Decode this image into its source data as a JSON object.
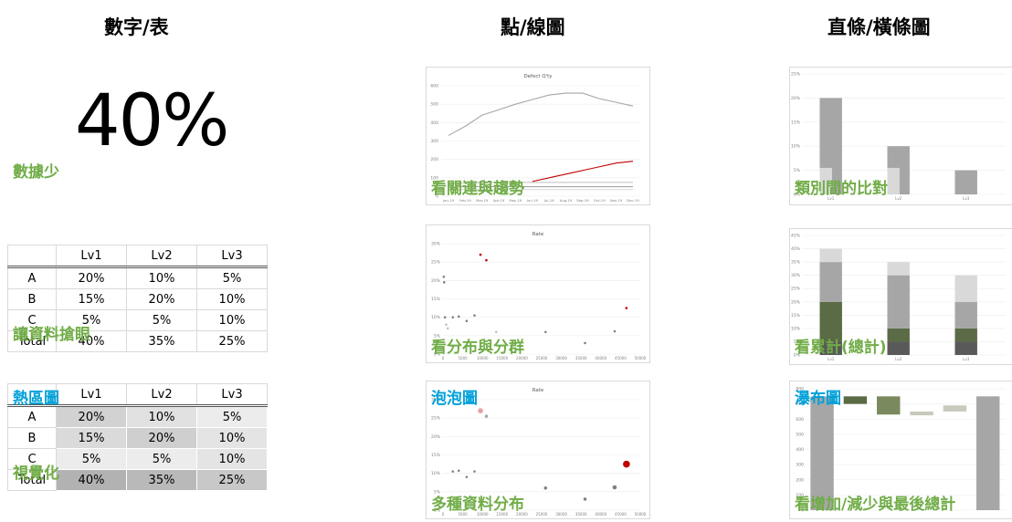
{
  "columns": {
    "numbers": "數字/表",
    "points": "點/線圖",
    "bars": "直條/橫條圖"
  },
  "numbers": {
    "big_value": "40%",
    "caption_few": "數據少",
    "caption_table": "讓資料搶眼",
    "caption_heat_title": "熱區圖",
    "caption_heat": "視覺化",
    "table": {
      "headers": [
        "",
        "Lv1",
        "Lv2",
        "Lv3"
      ],
      "rows": [
        [
          "A",
          "20%",
          "10%",
          "5%"
        ],
        [
          "B",
          "15%",
          "20%",
          "10%"
        ],
        [
          "C",
          "5%",
          "5%",
          "10%"
        ],
        [
          "Total",
          "40%",
          "35%",
          "25%"
        ]
      ]
    },
    "heat_levels": [
      [
        0.55,
        0.35,
        0.2
      ],
      [
        0.45,
        0.6,
        0.3
      ],
      [
        0.2,
        0.2,
        0.3
      ],
      [
        1.0,
        0.9,
        0.7
      ]
    ]
  },
  "cards": {
    "line": {
      "title": "Defect Q'ty",
      "caption": "看關連與趨勢"
    },
    "scatter": {
      "title": "Rate",
      "caption": "看分布與分群"
    },
    "bubble": {
      "title": "Rate",
      "caption_title": "泡泡圖",
      "caption": "多種資料分布"
    },
    "bar": {
      "caption": "類別間的比對"
    },
    "stacked": {
      "caption": "看累計(總計)"
    },
    "waterfall": {
      "caption_title": "瀑布圖",
      "caption": "看增加/減少與最後總計"
    }
  },
  "chart_data": [
    {
      "type": "line",
      "title": "Defect Q'ty",
      "categories": [
        "Jan-19",
        "Feb-19",
        "Mar-19",
        "Apr-19",
        "May-19",
        "Jun-19",
        "Jul-19",
        "Aug-19",
        "Sep-19",
        "Oct-19",
        "Nov-19",
        "Dec-19"
      ],
      "ylim": [
        0,
        600
      ],
      "yticks": [
        "0",
        "100",
        "200",
        "300",
        "400",
        "500",
        "600"
      ],
      "series": [
        {
          "color": "#a6a6a6",
          "values": [
            330,
            380,
            440,
            470,
            500,
            525,
            550,
            560,
            560,
            530,
            510,
            490
          ]
        },
        {
          "color": "#c00000",
          "values": [
            null,
            null,
            null,
            null,
            null,
            80,
            100,
            120,
            140,
            160,
            180,
            190
          ]
        },
        {
          "color": "#bfbfbf",
          "values": [
            70,
            72,
            74,
            75,
            75,
            75,
            75,
            75,
            75,
            75,
            75,
            75
          ]
        },
        {
          "color": "#a6a6a6",
          "values": [
            50,
            52,
            52,
            52,
            52,
            52,
            52,
            52,
            52,
            52,
            52,
            52
          ]
        },
        {
          "color": "#d9d9d9",
          "values": [
            35,
            36,
            36,
            36,
            36,
            36,
            36,
            36,
            36,
            36,
            36,
            36
          ]
        }
      ]
    },
    {
      "type": "scatter",
      "title": "Rate",
      "xlim": [
        0,
        50000
      ],
      "ylim": [
        0,
        0.3
      ],
      "xticks": [
        "0",
        "5000",
        "10000",
        "15000",
        "20000",
        "25000",
        "30000",
        "35000",
        "40000",
        "45000",
        "50000"
      ],
      "yticks": [
        "0%",
        "5%",
        "10%",
        "15%",
        "20%",
        "25%",
        "30%"
      ],
      "points": [
        {
          "x": 200,
          "y": 0.21,
          "c": "#808080"
        },
        {
          "x": 300,
          "y": 0.195,
          "c": "#808080"
        },
        {
          "x": 500,
          "y": 0.1,
          "c": "#808080"
        },
        {
          "x": 800,
          "y": 0.08,
          "c": "#bfbfbf"
        },
        {
          "x": 1200,
          "y": 0.07,
          "c": "#bfbfbf"
        },
        {
          "x": 2500,
          "y": 0.1,
          "c": "#808080"
        },
        {
          "x": 4000,
          "y": 0.102,
          "c": "#808080"
        },
        {
          "x": 6000,
          "y": 0.09,
          "c": "#808080"
        },
        {
          "x": 8000,
          "y": 0.105,
          "c": "#808080"
        },
        {
          "x": 9500,
          "y": 0.27,
          "c": "#c00000"
        },
        {
          "x": 11000,
          "y": 0.255,
          "c": "#c00000"
        },
        {
          "x": 13500,
          "y": 0.06,
          "c": "#bfbfbf"
        },
        {
          "x": 26000,
          "y": 0.06,
          "c": "#808080"
        },
        {
          "x": 36000,
          "y": 0.03,
          "c": "#808080"
        },
        {
          "x": 43500,
          "y": 0.062,
          "c": "#808080"
        },
        {
          "x": 46500,
          "y": 0.125,
          "c": "#c00000"
        }
      ]
    },
    {
      "type": "scatter",
      "title": "Rate",
      "xlim": [
        0,
        50000
      ],
      "ylim": [
        0,
        0.3
      ],
      "xticks": [
        "0",
        "5000",
        "10000",
        "15000",
        "20000",
        "25000",
        "30000",
        "35000",
        "40000",
        "45000",
        "50000"
      ],
      "yticks": [
        "0%",
        "5%",
        "10%",
        "15%",
        "20%",
        "25%",
        "30%"
      ],
      "points": [
        {
          "x": 2500,
          "y": 0.105,
          "c": "#808080",
          "r": 1.5
        },
        {
          "x": 4000,
          "y": 0.107,
          "c": "#808080",
          "r": 1.5
        },
        {
          "x": 6000,
          "y": 0.09,
          "c": "#808080",
          "r": 1.5
        },
        {
          "x": 8000,
          "y": 0.105,
          "c": "#808080",
          "r": 1.5
        },
        {
          "x": 9500,
          "y": 0.27,
          "c": "#e6a0a0",
          "r": 3
        },
        {
          "x": 11000,
          "y": 0.255,
          "c": "#a6a6a6",
          "r": 2
        },
        {
          "x": 26000,
          "y": 0.06,
          "c": "#808080",
          "r": 2
        },
        {
          "x": 36000,
          "y": 0.03,
          "c": "#808080",
          "r": 2
        },
        {
          "x": 43500,
          "y": 0.062,
          "c": "#808080",
          "r": 2.5
        },
        {
          "x": 46500,
          "y": 0.125,
          "c": "#c00000",
          "r": 4
        }
      ]
    },
    {
      "type": "bar",
      "categories": [
        "Lv1",
        "Lv2",
        "Lv3"
      ],
      "ylim": [
        0,
        0.25
      ],
      "yticks": [
        "0%",
        "5%",
        "10%",
        "15%",
        "20%",
        "25%"
      ],
      "values": [
        0.2,
        0.1,
        0.05
      ],
      "highlight": [
        0.055,
        0.055,
        0
      ]
    },
    {
      "type": "bar",
      "stacked": true,
      "categories": [
        "Lv1",
        "Lv2",
        "Lv3"
      ],
      "ylim": [
        0,
        0.45
      ],
      "yticks": [
        "0%",
        "5%",
        "10%",
        "15%",
        "20%",
        "25%",
        "30%",
        "35%",
        "40%",
        "45%"
      ],
      "series": [
        {
          "color": "#595959",
          "values": [
            0.05,
            0.05,
            0.05
          ]
        },
        {
          "color": "#5a6b46",
          "values": [
            0.15,
            0.05,
            0.05
          ]
        },
        {
          "color": "#a6a6a6",
          "values": [
            0.15,
            0.2,
            0.1
          ]
        },
        {
          "color": "#d9d9d9",
          "values": [
            0.05,
            0.05,
            0.1
          ]
        }
      ]
    },
    {
      "type": "bar",
      "waterfall": true,
      "ylim": [
        0,
        800
      ],
      "yticks": [
        "0",
        "100",
        "200",
        "300",
        "400",
        "500",
        "600",
        "700",
        "800"
      ],
      "bars": [
        {
          "base": 0,
          "value": 750,
          "color": "#a6a6a6"
        },
        {
          "base": 700,
          "value": 50,
          "color": "#5a6b46"
        },
        {
          "base": 630,
          "value": 120,
          "color": "#7a8a5e"
        },
        {
          "base": 625,
          "value": 25,
          "color": "#c9c9bd"
        },
        {
          "base": 650,
          "value": 40,
          "color": "#c9c9bd"
        },
        {
          "base": 0,
          "value": 750,
          "color": "#a6a6a6"
        }
      ]
    }
  ]
}
